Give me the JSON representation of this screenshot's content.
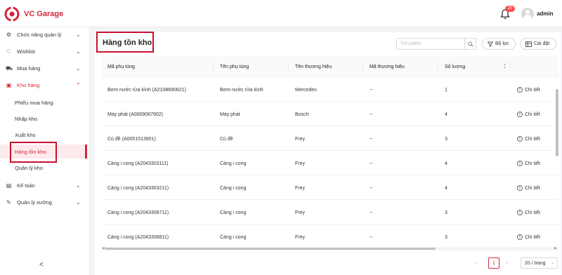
{
  "app": {
    "brand": "VC Garage",
    "notification_count": "20",
    "username": "admin"
  },
  "sidebar": {
    "items": [
      {
        "label": "Chức năng quản lý",
        "icon": "gear-icon"
      },
      {
        "label": "Wishlist",
        "icon": "heart-icon"
      },
      {
        "label": "Mua hàng",
        "icon": "cart-icon"
      },
      {
        "label": "Kho hàng",
        "icon": "warehouse-icon"
      },
      {
        "label": "Kế toán",
        "icon": "calculator-icon"
      },
      {
        "label": "Quản lý xưởng",
        "icon": "wrench-icon"
      }
    ],
    "subitems": [
      {
        "label": "Phiếu mua hàng"
      },
      {
        "label": "Nhập kho"
      },
      {
        "label": "Xuất kho"
      },
      {
        "label": "Hàng tồn kho"
      },
      {
        "label": "Quản lý kho"
      }
    ],
    "collapse_glyph": "<"
  },
  "page": {
    "title": "Hàng tồn kho"
  },
  "toolbar": {
    "search_placeholder": "Tìm kiếm",
    "filter_label": "Bộ lọc",
    "settings_label": "Cài đặt"
  },
  "table": {
    "headers": [
      "Mã phụ tùng",
      "Tên phụ tùng",
      "Tên thương hiệu",
      "Mã thương hiệu",
      "Số lượng"
    ],
    "detail_label": "Chi tiết",
    "rows": [
      [
        "Bơm nước rửa kính (A2108690821)",
        "Bơm nước rửa kính",
        "Mercedes",
        "--",
        "1"
      ],
      [
        "Máy phát (A0009067902)",
        "Máy phát",
        "Bosch",
        "--",
        "4"
      ],
      [
        "Củ đề (A0051513901)",
        "Củ đề",
        "Frey",
        "--",
        "3"
      ],
      [
        "Càng i cong (A2043303111)",
        "Càng i cong",
        "Frey",
        "--",
        "4"
      ],
      [
        "Càng i cong (A2043303211)",
        "Càng i cong",
        "Frey",
        "--",
        "4"
      ],
      [
        "Càng i cong (A2043308711)",
        "Càng i cong",
        "Frey",
        "--",
        "3"
      ],
      [
        "Càng i cong (A2043308811)",
        "Càng i cong",
        "Frey",
        "--",
        "3"
      ]
    ]
  },
  "pagination": {
    "current_page": "1",
    "page_size": "20 / trang"
  },
  "colors": {
    "brand": "#d6263a",
    "highlight": "#c8102e"
  }
}
